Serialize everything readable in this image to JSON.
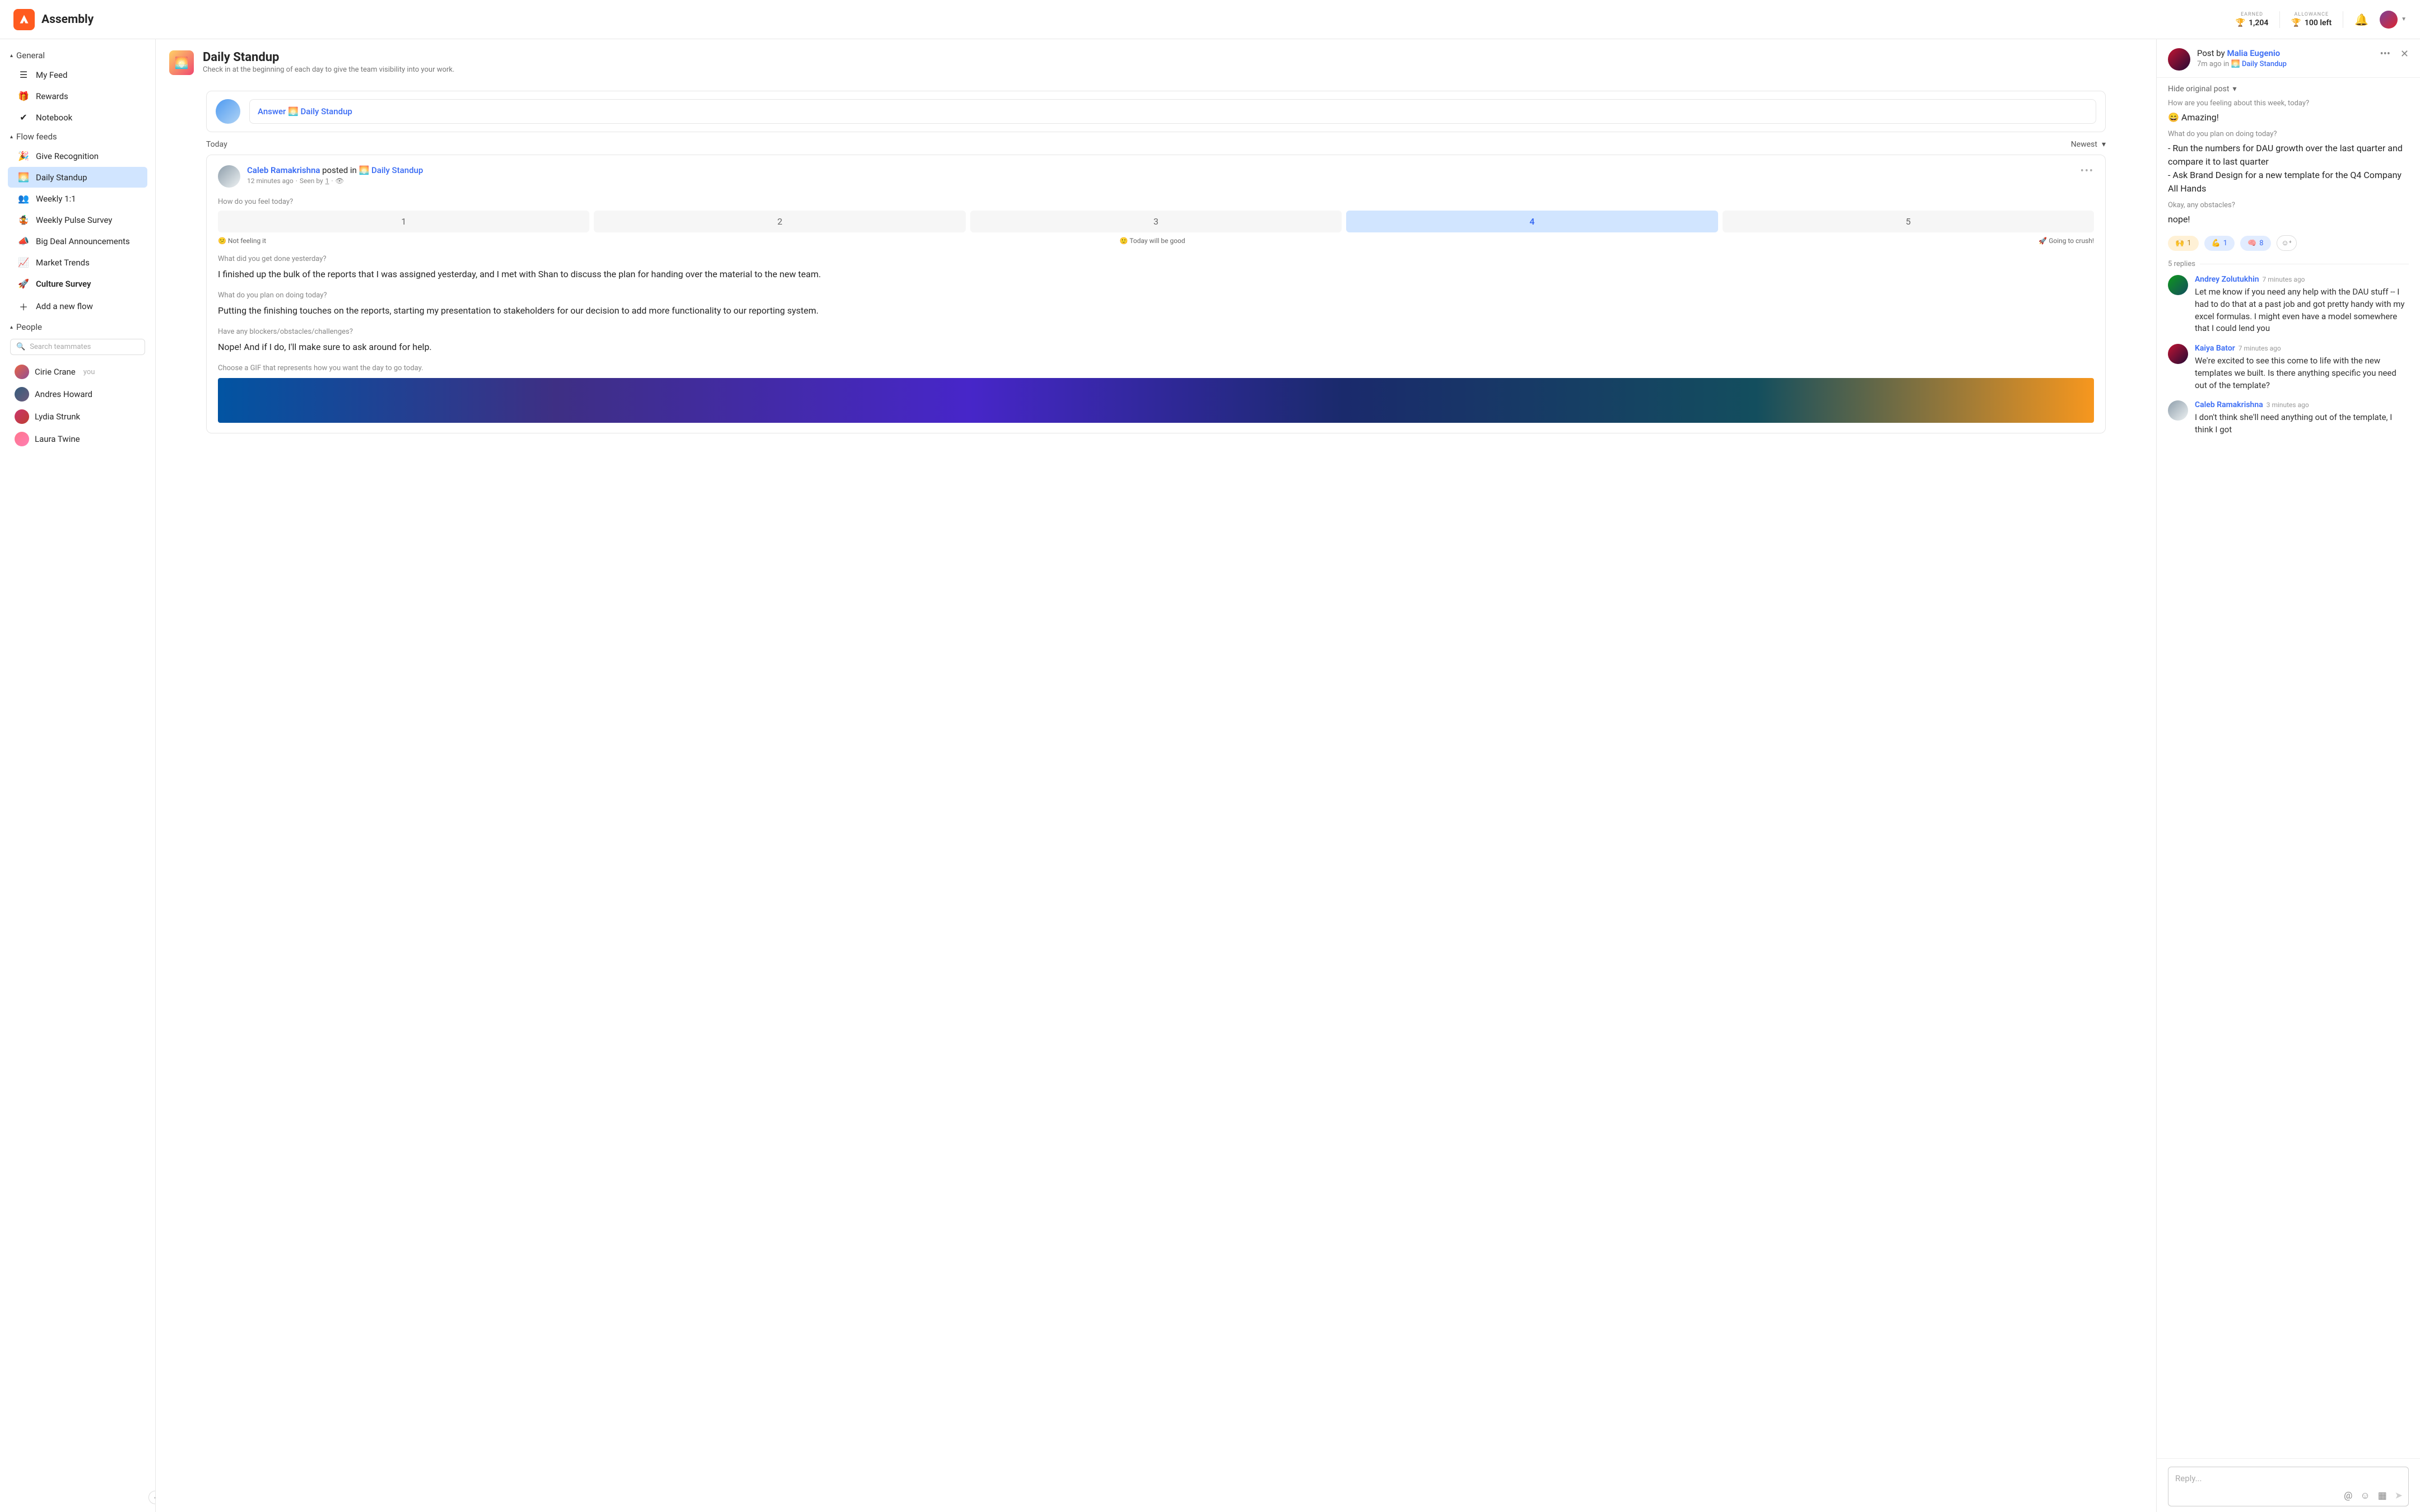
{
  "brand": "Assembly",
  "stats": {
    "earned_label": "EARNED",
    "earned": "1,204",
    "allowance_label": "ALLOWANCE",
    "allowance": "100 left"
  },
  "sidebar": {
    "general": {
      "head": "General",
      "myfeed": "My Feed",
      "rewards": "Rewards",
      "notebook": "Notebook"
    },
    "flows": {
      "head": "Flow feeds",
      "items": [
        "Give Recognition",
        "Daily Standup",
        "Weekly 1:1",
        "Weekly Pulse Survey",
        "Big Deal Announcements",
        "Market Trends",
        "Culture Survey"
      ],
      "add": "Add a new flow"
    },
    "people": {
      "head": "People",
      "search_ph": "Search teammates",
      "list": [
        "Cirie Crane",
        "Andres Howard",
        "Lydia Strunk",
        "Laura Twine"
      ],
      "you": "you"
    }
  },
  "feed": {
    "title": "Daily Standup",
    "sub": "Check in at the beginning of each day to give the team visibility into your work.",
    "answer_prefix": "Answer ",
    "answer_flow": "Daily Standup",
    "today": "Today",
    "sort": "Newest",
    "post": {
      "author": "Caleb Ramakrishna",
      "verb": " posted in ",
      "flow": "Daily Standup",
      "time": "12 minutes ago",
      "seen_pre": "Seen by ",
      "seen": "1",
      "q1": "How do you feel today?",
      "scale": [
        "1",
        "2",
        "3",
        "4",
        "5"
      ],
      "scale_sel": 3,
      "scale_l": "Not feeling it",
      "scale_m": "Today will be good",
      "scale_r": "Going to crush!",
      "q2": "What did you get done yesterday?",
      "a2": "I finished up the bulk of the reports that I was assigned yesterday, and I met with Shan to discuss the plan for handing over the material to the new team.",
      "q3": "What do you plan on doing today?",
      "a3": "Putting the finishing touches on the reports, starting my presentation to stakeholders for our decision to add more functionality to our reporting system.",
      "q4": "Have any blockers/obstacles/challenges?",
      "a4": "Nope! And if I do, I'll make sure to ask around for help.",
      "q5": "Choose a GIF that represents how you want the day to go today."
    }
  },
  "detail": {
    "by_pre": "Post by ",
    "author": "Malia Eugenio",
    "time": "7m ago in ",
    "flow": "Daily Standup",
    "hide": "Hide original post",
    "q1": "How are you feeling about this week, today?",
    "a1": "Amazing!",
    "q2": "What do you plan on doing today?",
    "a2a": "- Run the numbers for DAU growth over the last quarter and compare it to last quarter",
    "a2b": "- Ask Brand Design for a new template for the Q4 Company All Hands",
    "q3": "Okay, any obstacles?",
    "a3": "nope!",
    "react1": "1",
    "react2": "1",
    "react3": "8",
    "replies_h": "5 replies",
    "replies": [
      {
        "author": "Andrey Zolutukhin",
        "time": "7 minutes ago",
        "body": "Let me know if you need any help with the DAU stuff -- I had to do that at a past job and got pretty handy with my excel formulas. I might even have a model somewhere that I could lend you"
      },
      {
        "author": "Kaiya Bator",
        "time": "7 minutes ago",
        "body": "We're excited to see this come to life with the new templates we built. Is there anything specific you need out of the template?"
      },
      {
        "author": "Caleb Ramakrishna",
        "time": "3 minutes ago",
        "body": "I don't think she'll need anything out of the template, I think I got"
      }
    ],
    "reply_ph": "Reply..."
  }
}
